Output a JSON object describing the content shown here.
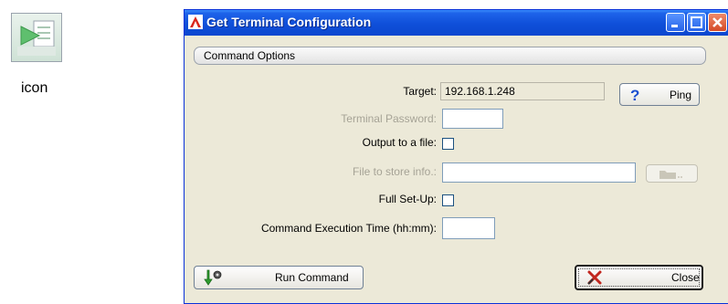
{
  "desktop": {
    "icon_caption": "icon"
  },
  "window": {
    "title": "Get Terminal Configuration",
    "group_title": "Command Options",
    "fields": {
      "target_label": "Target:",
      "target_value": "192.168.1.248",
      "ping_label": "Ping",
      "password_label": "Terminal Password:",
      "password_value": "",
      "output_file_label": "Output to a file:",
      "output_file_checked": false,
      "file_store_label": "File to store info.:",
      "file_store_value": "",
      "browse_label": "...",
      "full_setup_label": "Full Set-Up:",
      "full_setup_checked": false,
      "exec_time_label": "Command Execution Time (hh:mm):",
      "exec_time_value": ""
    },
    "buttons": {
      "run_label": "Run Command",
      "close_label": "Close"
    }
  },
  "colors": {
    "titlebar": "#0f4fd9",
    "dialog_bg": "#ece9d8",
    "disabled_text": "#a6a396"
  }
}
